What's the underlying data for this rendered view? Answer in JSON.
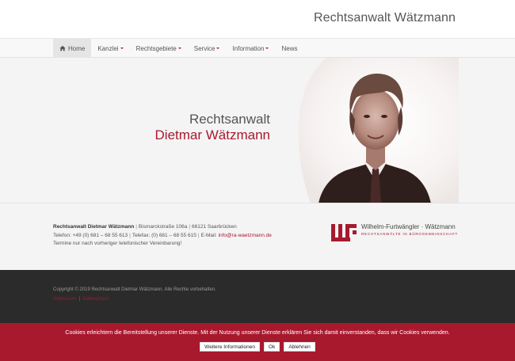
{
  "header": {
    "site_title": "Rechtsanwalt Wätzmann"
  },
  "nav": {
    "items": [
      {
        "label": "Home",
        "icon": "home-icon",
        "active": true,
        "dropdown": false
      },
      {
        "label": "Kanzlei",
        "dropdown": true
      },
      {
        "label": "Rechtsgebiete",
        "dropdown": true
      },
      {
        "label": "Service",
        "dropdown": true
      },
      {
        "label": "Information",
        "dropdown": true
      },
      {
        "label": "News",
        "dropdown": false
      }
    ]
  },
  "hero": {
    "line1": "Rechtsanwalt",
    "line2": "Dietmar Wätzmann"
  },
  "contact": {
    "name": "Rechtsanwalt Dietmar Wätzmann",
    "street": "Bismarckstraße 106a",
    "city": "66121 Saarbrücken",
    "phone": "Telefon: +49 (0) 681 – 68 55 613",
    "fax": "Telefax: (0) 681 – 68 55 615",
    "email_label": "E-Mail:",
    "email": "info@ra-waetzmann.de",
    "note": "Termine nur nach vorheriger telefonischer Vereinbarung!"
  },
  "logo": {
    "name": "Wilhelm-Furtwängler · Wätzmann",
    "subtitle": "RECHTSANWÄLTE IN BÜROGEMEINSCHAFT"
  },
  "footer": {
    "copyright": "Copyright © 2019 Rechtsanwalt Dietmar Wätzmann. Alle Rechte vorbehalten.",
    "links": [
      "Impressum",
      "Datenschutz"
    ]
  },
  "cookie_banner": {
    "text": "Cookies erleichtern die Bereitstellung unserer Dienste. Mit der Nutzung unserer Dienste erklären Sie sich damit einverstanden, dass wir Cookies verwenden.",
    "more_label": "Weitere Informationen",
    "ok_label": "Ok",
    "decline_label": "Ablehnen"
  },
  "colors": {
    "accent": "#a8192e",
    "footer_bg": "#2b2b2b",
    "hero_bg": "#f4f4f4"
  }
}
